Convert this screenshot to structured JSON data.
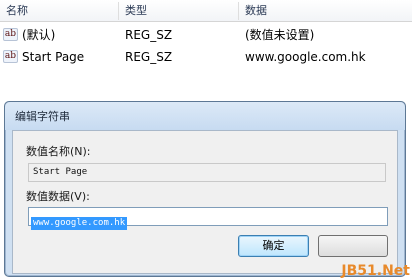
{
  "list": {
    "columns": [
      "名称",
      "类型",
      "数据"
    ],
    "rows": [
      {
        "name": "(默认)",
        "type": "REG_SZ",
        "data": "(数值未设置)"
      },
      {
        "name": "Start Page",
        "type": "REG_SZ",
        "data": "www.google.com.hk"
      }
    ],
    "row_icon": "registry-string-icon"
  },
  "dialog": {
    "title": "编辑字符串",
    "value_name_label": "数值名称(N):",
    "value_name": "Start Page",
    "value_data_label": "数值数据(V):",
    "value_data": "www.google.com.hk",
    "ok_label": "确定",
    "cancel_label": ""
  },
  "watermark": "JB51.Net",
  "colors": {
    "selection": "#3399ff",
    "default_button_border": "#3c7fb1",
    "watermark": "#e88a2b"
  }
}
